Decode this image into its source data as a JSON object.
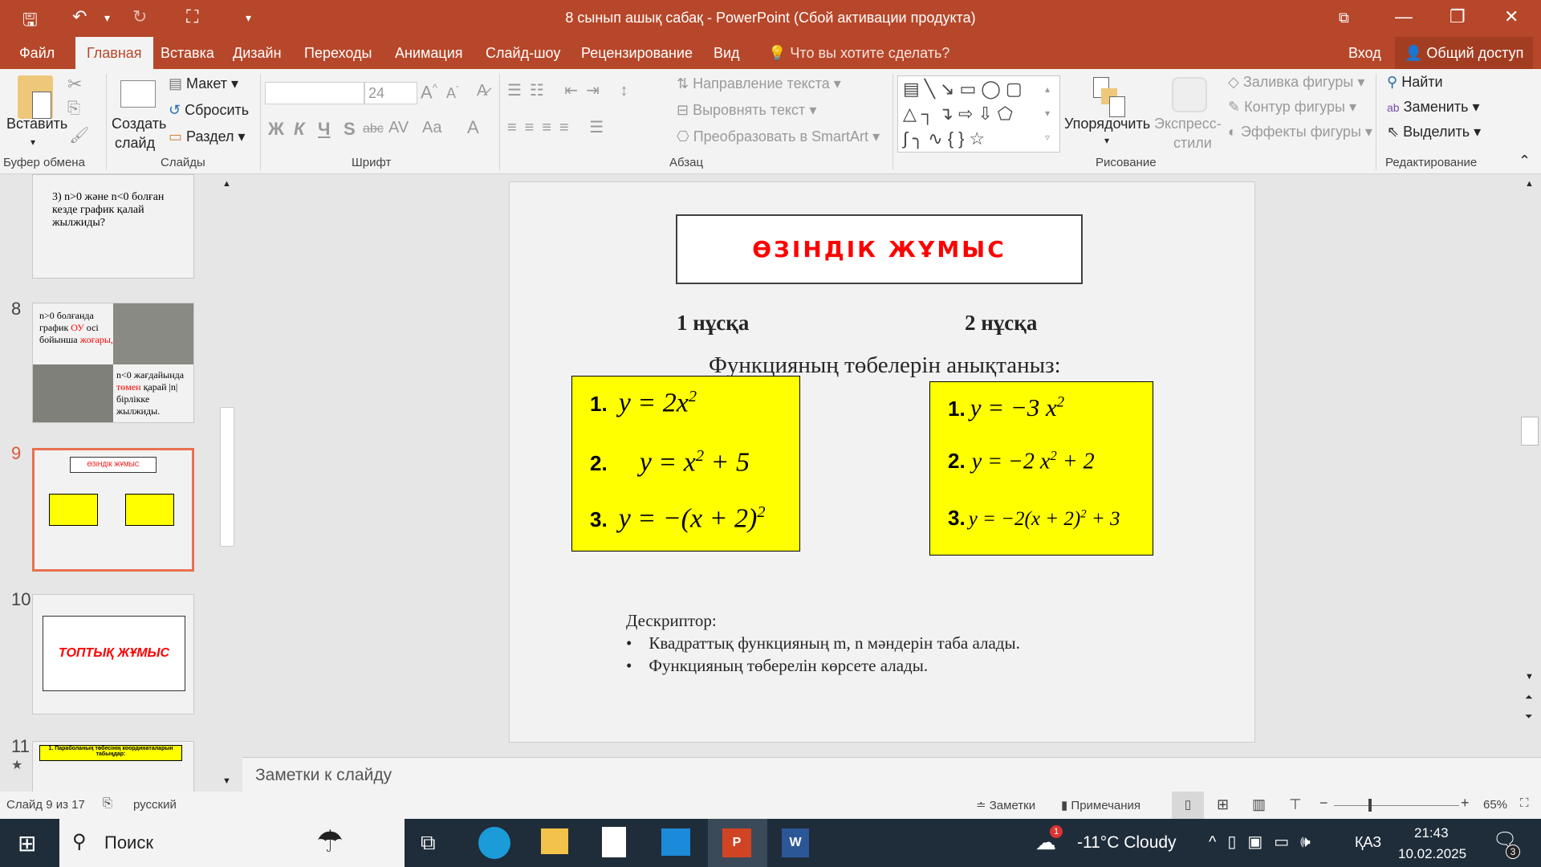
{
  "window": {
    "title": "8 сынып ашық сабақ - PowerPoint (Сбой активации продукта)"
  },
  "menu": {
    "tabs": [
      "Файл",
      "Главная",
      "Вставка",
      "Дизайн",
      "Переходы",
      "Анимация",
      "Слайд-шоу",
      "Рецензирование",
      "Вид"
    ],
    "tell_me": "Что вы хотите сделать?",
    "sign_in": "Вход",
    "share": "Общий доступ"
  },
  "ribbon": {
    "clipboard": {
      "paste": "Вставить",
      "group": "Буфер обмена"
    },
    "slides": {
      "new_slide_1": "Создать",
      "new_slide_2": "слайд",
      "layout": "Макет",
      "reset": "Сбросить",
      "section": "Раздел",
      "group": "Слайды"
    },
    "font": {
      "name": "",
      "size": "24",
      "bold": "Ж",
      "italic": "К",
      "underline": "Ч",
      "shadow": "S",
      "strike": "abc",
      "spacing": "AV",
      "case": "Aa",
      "color": "A",
      "group": "Шрифт"
    },
    "paragraph": {
      "direction": "Направление текста",
      "align": "Выровнять текст",
      "smartart": "Преобразовать в SmartArt",
      "group": "Абзац"
    },
    "drawing": {
      "arrange": "Упорядочить",
      "styles_1": "Экспресс-",
      "styles_2": "стили",
      "fill": "Заливка фигуры",
      "outline": "Контур фигуры",
      "effects": "Эффекты фигуры",
      "group": "Рисование"
    },
    "editing": {
      "find": "Найти",
      "replace": "Заменить",
      "select": "Выделить",
      "group": "Редактирование"
    }
  },
  "thumbnails": [
    {
      "num": "",
      "text": "3) n>0 және n<0 болған кезде график қалай жылжиды?"
    },
    {
      "num": "8",
      "text_a": "n>0 болғанда график ",
      "text_b": "ОУ",
      "text_c": " осі бойынша ",
      "text_d": "жоғары,",
      "text_e": "n<0 жағдайында ",
      "text_f": "төмен",
      "text_g": " қарай |n| бірлікке жылжиды."
    },
    {
      "num": "9",
      "title": "ӨЗІНДІК ЖҰМЫС"
    },
    {
      "num": "10",
      "title": "ТОПТЫҚ ЖҰМЫС"
    },
    {
      "num": "11",
      "title": "1. Параболаның төбесінің координаталарын табыңдар:"
    }
  ],
  "slide": {
    "title": "ӨЗІНДІК ЖҰМЫС",
    "variant1": "1 нұсқа",
    "variant2": "2 нұсқа",
    "task": "Функцияның төбелерін анықтаныз:",
    "box1": [
      {
        "n": "1.",
        "f": "y = 2x",
        "sup": "2",
        "tail": ""
      },
      {
        "n": "2.",
        "f": "y = x",
        "sup": "2",
        "tail": " + 5"
      },
      {
        "n": "3.",
        "f": "y = −(x + 2)",
        "sup": "2",
        "tail": ""
      }
    ],
    "box2": [
      {
        "n": "1.",
        "f": "y = −3 x",
        "sup": "2",
        "tail": ""
      },
      {
        "n": "2.",
        "f": "y = −2 x",
        "sup": "2",
        "tail": " + 2"
      },
      {
        "n": "3.",
        "f": "y = −2(x + 2)",
        "sup": "2",
        "tail": " + 3"
      }
    ],
    "descriptor_label": "Дескриптор:",
    "descriptor_items": [
      "Квадраттық функцияның m, n мәндерін таба алады.",
      "Функцияның төберелін көрсете алады."
    ]
  },
  "notes": {
    "placeholder": "Заметки к слайду"
  },
  "status": {
    "slide_info": "Слайд 9 из 17",
    "language": "русский",
    "notes": "Заметки",
    "comments": "Примечания",
    "zoom": "65%",
    "zoom_fraction": 0.65
  },
  "taskbar": {
    "search": "Поиск",
    "weather": "-11°C  Cloudy",
    "weather_badge": "1",
    "lang": "ҚАЗ",
    "time": "21:43",
    "date": "10.02.2025",
    "notif_count": "3"
  },
  "colors": {
    "accent": "#b7472a",
    "title_red": "#ff0000",
    "box": "#ffff00",
    "selected": "#e8714f"
  }
}
